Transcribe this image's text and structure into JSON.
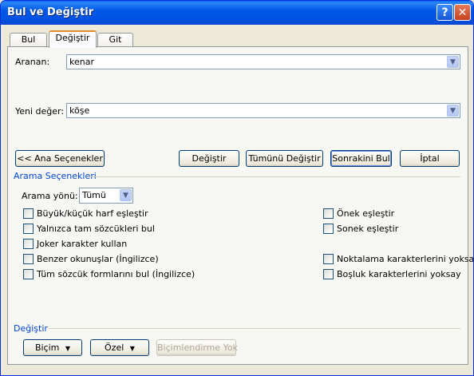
{
  "window": {
    "title": "Bul ve Değiştir"
  },
  "titlebar_buttons": {
    "help": "?",
    "close": "✕"
  },
  "tabs": [
    "Bul",
    "Değiştir",
    "Git"
  ],
  "find": {
    "label": "Aranan:",
    "value": "kenar"
  },
  "replace": {
    "label": "Yeni değer:",
    "value": "köşe"
  },
  "buttons": {
    "less": "<< Ana Seçenekler",
    "replace": "Değiştir",
    "replace_all": "Tümünü Değiştir",
    "find_next": "Sonrakini Bul",
    "cancel": "İptal"
  },
  "search_options": {
    "title": "Arama Seçenekleri",
    "direction_label": "Arama yönü:",
    "direction_value": "Tümü",
    "left": [
      "Büyük/küçük harf eşleştir",
      "Yalnızca tam sözcükleri bul",
      "Joker karakter kullan",
      "Benzer okunuşlar (İngilizce)",
      "Tüm sözcük formlarını bul (İngilizce)"
    ],
    "right_top": [
      "Önek eşleştir",
      "Sonek eşleştir"
    ],
    "right_bottom": [
      "Noktalama karakterlerini yoksay",
      "Boşluk karakterlerini yoksay"
    ]
  },
  "replace_section": {
    "title": "Değiştir",
    "format_button": "Biçim",
    "special_button": "Özel",
    "no_format_button": "Biçimlendirme Yok"
  }
}
